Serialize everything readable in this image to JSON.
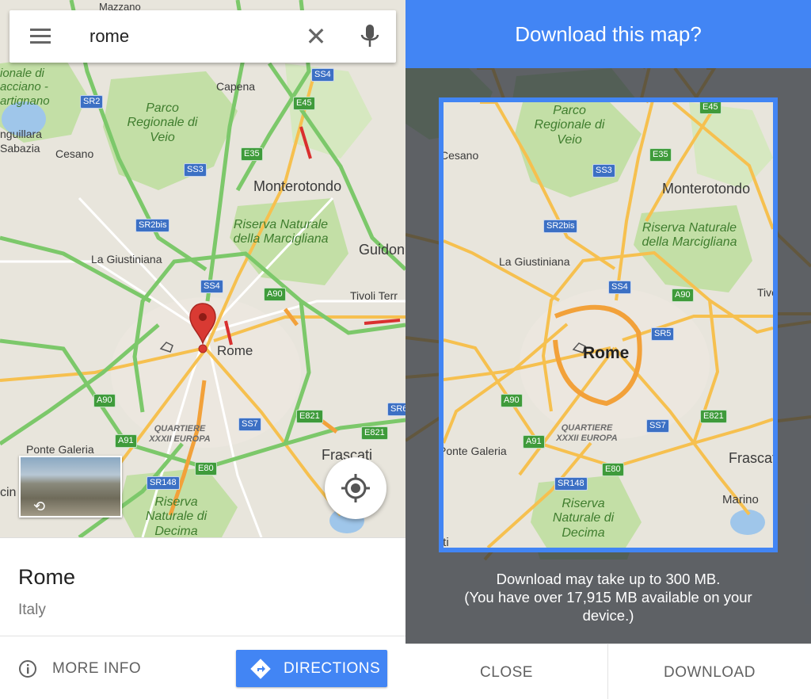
{
  "search": {
    "query": "rome"
  },
  "map": {
    "places": {
      "mazzano": "Mazzano",
      "capena": "Capena",
      "cesano": "Cesano",
      "monterotondo": "Monterotondo",
      "la_giustiniana": "La Giustiniana",
      "guidonia": "Guidon",
      "tivoli": "Tivoli Terr",
      "rome": "Rome",
      "ponte_galeria": "Ponte Galeria",
      "frascati": "Frascati",
      "marino": "Marino",
      "anguillara": "nguillara",
      "sabazia": "Sabazia",
      "ostia": "Osti",
      "acilia": "cin"
    },
    "parks": {
      "veio": "Parco Regionale di Veio",
      "marcigliana": "Riserva Naturale della Marcigliana",
      "decima": "Riserva Naturale di Decima",
      "bracciano": "ionale di acciano - artignano"
    },
    "district": "QUARTIERE XXXII EUROPA",
    "shields": {
      "ss4": "SS4",
      "sr2": "SR2",
      "e45": "E45",
      "e35": "E35",
      "ss3": "SS3",
      "sr2bis": "SR2bis",
      "ss4b": "SS4",
      "a90": "A90",
      "a90b": "A90",
      "ss7": "SS7",
      "e821": "E821",
      "e821b": "E821",
      "sr6": "SR6",
      "a91": "A91",
      "e80": "E80",
      "sr148": "SR148",
      "sr5": "SR5"
    }
  },
  "place": {
    "name": "Rome",
    "subtitle": "Italy"
  },
  "actions": {
    "more_info": "MORE INFO",
    "directions": "DIRECTIONS"
  },
  "download": {
    "title": "Download this map?",
    "message_line1": "Download may take up to 300 MB.",
    "message_line2": "(You have over 17,915 MB available on your",
    "message_line3": "device.)",
    "close": "CLOSE",
    "download": "DOWNLOAD"
  },
  "colors": {
    "accent": "#4285f4",
    "map_bg": "#e8e5dc",
    "park": "#c3dfa6",
    "road_major": "#7cc86a",
    "road_arterial": "#f6c04f",
    "traffic_red": "#d9302f",
    "pin": "#d93a33"
  },
  "icons": {
    "menu": "menu-icon",
    "clear": "close-icon",
    "mic": "mic-icon",
    "pin": "map-pin-icon",
    "location": "my-location-icon",
    "info": "info-icon",
    "directions": "directions-icon",
    "street_view": "street-view-icon"
  }
}
